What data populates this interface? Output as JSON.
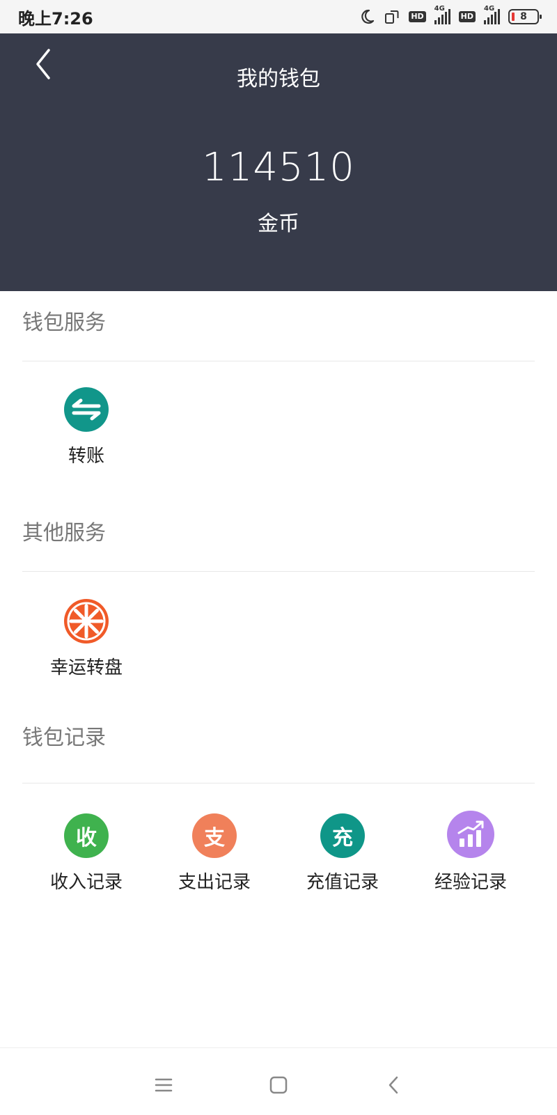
{
  "status_bar": {
    "time": "晚上7:26",
    "icons": [
      "moon-icon",
      "screen-rotate-icon",
      "hd-badge",
      "4g-signal-icon",
      "hd-badge",
      "4g-signal-icon",
      "battery-icon"
    ],
    "hd_label": "HD",
    "network_label": "4G",
    "battery_level": "8",
    "battery_color": "#e53935"
  },
  "header": {
    "title": "我的钱包",
    "balance": "114510",
    "balance_unit": "金币",
    "background": "#373b4a"
  },
  "sections": [
    {
      "title": "钱包服务",
      "items": [
        {
          "label": "转账",
          "icon": "transfer-icon",
          "color": "#11968a"
        }
      ]
    },
    {
      "title": "其他服务",
      "items": [
        {
          "label": "幸运转盘",
          "icon": "lucky-wheel-icon",
          "color": "#f05a28"
        }
      ]
    },
    {
      "title": "钱包记录",
      "items": [
        {
          "label": "收入记录",
          "icon_text": "收",
          "color": "#3fb24e"
        },
        {
          "label": "支出记录",
          "icon_text": "支",
          "color": "#f0805a"
        },
        {
          "label": "充值记录",
          "icon_text": "充",
          "color": "#0f9688"
        },
        {
          "label": "经验记录",
          "icon": "bar-chart-icon",
          "color": "#b584ec"
        }
      ]
    }
  ],
  "nav_bar": {
    "buttons": [
      "menu-icon",
      "home-icon",
      "back-icon"
    ]
  }
}
